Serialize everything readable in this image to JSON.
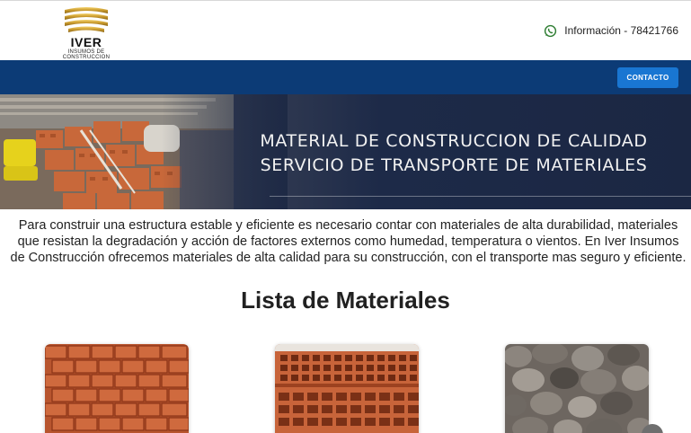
{
  "header": {
    "logo_name": "IVER",
    "logo_tagline": "INSUMOS DE CONSTRUCCION",
    "contact_text": "Información - 78421766",
    "contact_icon": "whatsapp-icon"
  },
  "navbar": {
    "contact_button": "CONTACTO",
    "color": "#0c3b76",
    "button_color": "#1976d2"
  },
  "hero": {
    "line1": "MATERIAL DE CONSTRUCCION DE CALIDAD",
    "line2": "SERVICIO DE TRANSPORTE DE MATERIALES"
  },
  "intro": {
    "text": "Para construir una estructura estable y eficiente es necesario contar con materiales de alta durabilidad, materiales que resistan la degradación y acción de factores externos como humedad, temperatura o vientos. En Iver Insumos de Construcción ofrecemos materiales de alta calidad para su construcción, con el transporte mas seguro y eficiente."
  },
  "materials": {
    "title": "Lista de Materiales",
    "items": [
      {
        "image": "solid-bricks-image"
      },
      {
        "image": "hollow-bricks-image"
      },
      {
        "image": "river-stones-image"
      }
    ]
  }
}
